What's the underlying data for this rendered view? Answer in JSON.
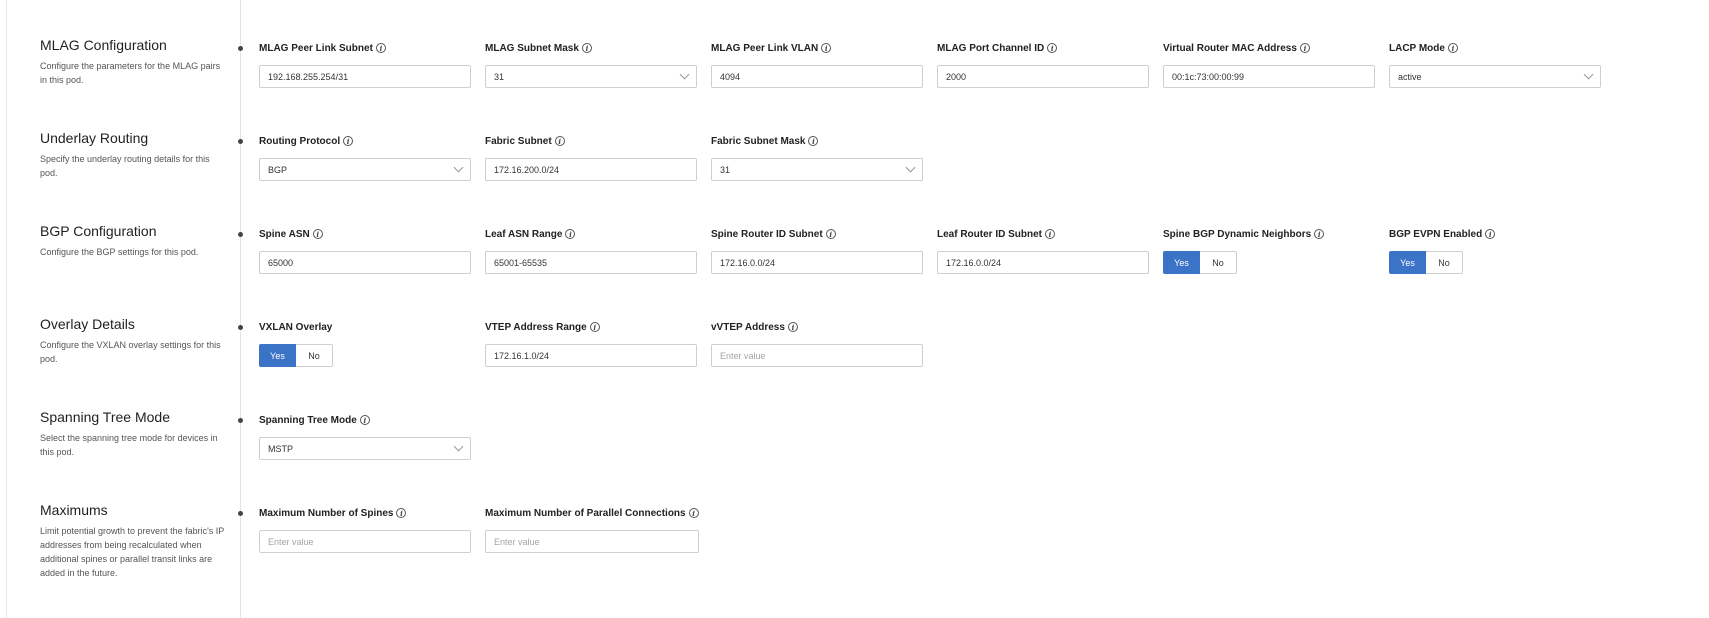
{
  "sections": {
    "mlag": {
      "title": "MLAG Configuration",
      "description": "Configure the parameters for the MLAG pairs in this pod.",
      "peer_link_subnet": {
        "label": "MLAG Peer Link Subnet",
        "value": "192.168.255.254/31"
      },
      "subnet_mask": {
        "label": "MLAG Subnet Mask",
        "value": "31"
      },
      "peer_link_vlan": {
        "label": "MLAG Peer Link VLAN",
        "value": "4094"
      },
      "port_channel_id": {
        "label": "MLAG Port Channel ID",
        "value": "2000"
      },
      "virtual_router_mac": {
        "label": "Virtual Router MAC Address",
        "value": "00:1c:73:00:00:99"
      },
      "lacp_mode": {
        "label": "LACP Mode",
        "value": "active"
      }
    },
    "underlay": {
      "title": "Underlay Routing",
      "description": "Specify the underlay routing details for this pod.",
      "routing_protocol": {
        "label": "Routing Protocol",
        "value": "BGP"
      },
      "fabric_subnet": {
        "label": "Fabric Subnet",
        "value": "172.16.200.0/24"
      },
      "fabric_subnet_mask": {
        "label": "Fabric Subnet Mask",
        "value": "31"
      }
    },
    "bgp": {
      "title": "BGP Configuration",
      "description": "Configure the BGP settings for this pod.",
      "spine_asn": {
        "label": "Spine ASN",
        "value": "65000"
      },
      "leaf_asn_range": {
        "label": "Leaf ASN Range",
        "value": "65001-65535"
      },
      "spine_router_id_subnet": {
        "label": "Spine Router ID Subnet",
        "value": "172.16.0.0/24"
      },
      "leaf_router_id_subnet": {
        "label": "Leaf Router ID Subnet",
        "value": "172.16.0.0/24"
      },
      "spine_dynamic_neighbors": {
        "label": "Spine BGP Dynamic Neighbors",
        "selected": "Yes"
      },
      "evpn_enabled": {
        "label": "BGP EVPN Enabled",
        "selected": "Yes"
      }
    },
    "overlay": {
      "title": "Overlay Details",
      "description": "Configure the VXLAN overlay settings for this pod.",
      "vxlan_overlay": {
        "label": "VXLAN Overlay",
        "selected": "Yes"
      },
      "vtep_address_range": {
        "label": "VTEP Address Range",
        "value": "172.16.1.0/24"
      },
      "vvtep_address": {
        "label": "vVTEP Address",
        "value": "",
        "placeholder": "Enter value"
      }
    },
    "stp": {
      "title": "Spanning Tree Mode",
      "description": "Select the spanning tree mode for devices in this pod.",
      "mode": {
        "label": "Spanning Tree Mode",
        "value": "MSTP"
      }
    },
    "maximums": {
      "title": "Maximums",
      "description": "Limit potential growth to prevent the fabric's IP addresses from being recalculated when additional spines or parallel transit links are added in the future.",
      "max_spines": {
        "label": "Maximum Number of Spines",
        "value": "",
        "placeholder": "Enter value"
      },
      "max_parallel": {
        "label": "Maximum Number of Parallel Connections",
        "value": "",
        "placeholder": "Enter value"
      }
    }
  },
  "toggle_labels": {
    "yes": "Yes",
    "no": "No"
  },
  "icons": {
    "info": "info-icon",
    "dropdown": "chevron-down-icon"
  },
  "colors": {
    "accent": "#3b73c7"
  }
}
